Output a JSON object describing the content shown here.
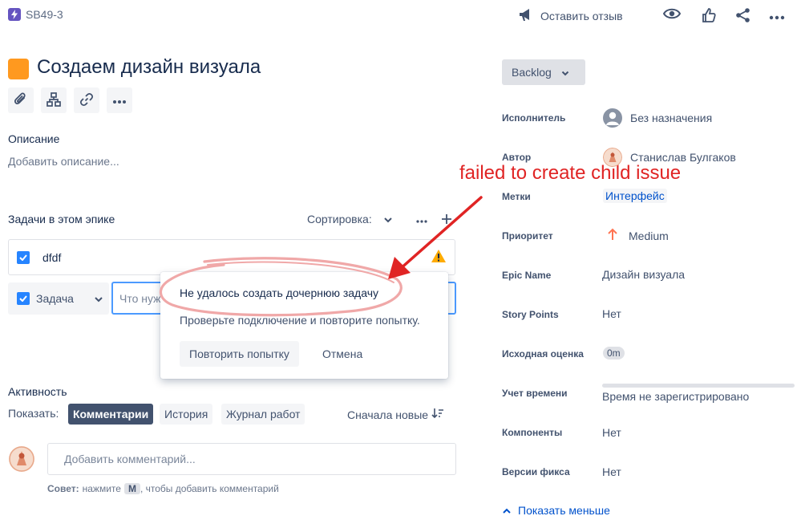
{
  "header": {
    "issue_key": "SB49-3",
    "feedback_label": "Оставить отзыв"
  },
  "issue": {
    "title": "Создаем дизайн визуала"
  },
  "description": {
    "heading": "Описание",
    "placeholder": "Добавить описание..."
  },
  "epic_tasks": {
    "heading": "Задачи в этом эпике",
    "sort_label": "Сортировка:",
    "child_item": "dfdf",
    "type_selector": "Задача",
    "input_placeholder": "Что нуж"
  },
  "error_popup": {
    "title": "Не удалось создать дочернюю задачу",
    "message": "Проверьте подключение и повторите попытку.",
    "retry_label": "Повторить попытку",
    "cancel_label": "Отмена"
  },
  "annotation": {
    "text": "failed to create child issue",
    "color": "#e02424"
  },
  "activity": {
    "heading": "Активность",
    "show_label": "Показать:",
    "tabs": [
      "Комментарии",
      "История",
      "Журнал работ"
    ],
    "sort_label": "Сначала новые",
    "comment_placeholder": "Добавить комментарий...",
    "tip_prefix": "Совет:",
    "tip_middle": "нажмите",
    "tip_key": "M",
    "tip_suffix": ", чтобы добавить комментарий"
  },
  "sidebar": {
    "status": "Backlog",
    "fields": [
      {
        "label": "Исполнитель",
        "value": "Без назначения"
      },
      {
        "label": "Автор",
        "value": "Станислав Булгаков"
      },
      {
        "label": "Метки",
        "value": "Интерфейс"
      },
      {
        "label": "Приоритет",
        "value": "Medium"
      },
      {
        "label": "Epic Name",
        "value": "Дизайн визуала"
      },
      {
        "label": "Story Points",
        "value": "Нет"
      },
      {
        "label": "Исходная оценка",
        "value": "0m"
      },
      {
        "label": "Учет времени",
        "value": "Время не зарегистрировано"
      },
      {
        "label": "Компоненты",
        "value": "Нет"
      },
      {
        "label": "Версии фикса",
        "value": "Нет"
      }
    ],
    "show_less": "Показать меньше"
  },
  "colors": {
    "accent": "#0052cc",
    "epic_orange": "#ff991f",
    "lightning_purple": "#6554c0",
    "warning": "#ffab00",
    "checkbox_blue": "#2684ff",
    "priority_orange": "#ff7452",
    "active_tab": "#42526e"
  },
  "icons": [
    "lightning-icon",
    "megaphone-icon",
    "eye-icon",
    "thumbs-up-icon",
    "share-icon",
    "more-icon",
    "attachment-icon",
    "hierarchy-icon",
    "link-icon",
    "warning-icon",
    "checkbox-icon",
    "chevron-down-icon",
    "plus-icon",
    "user-icon",
    "arrow-up-icon",
    "chevron-up-icon",
    "sort-icon"
  ]
}
